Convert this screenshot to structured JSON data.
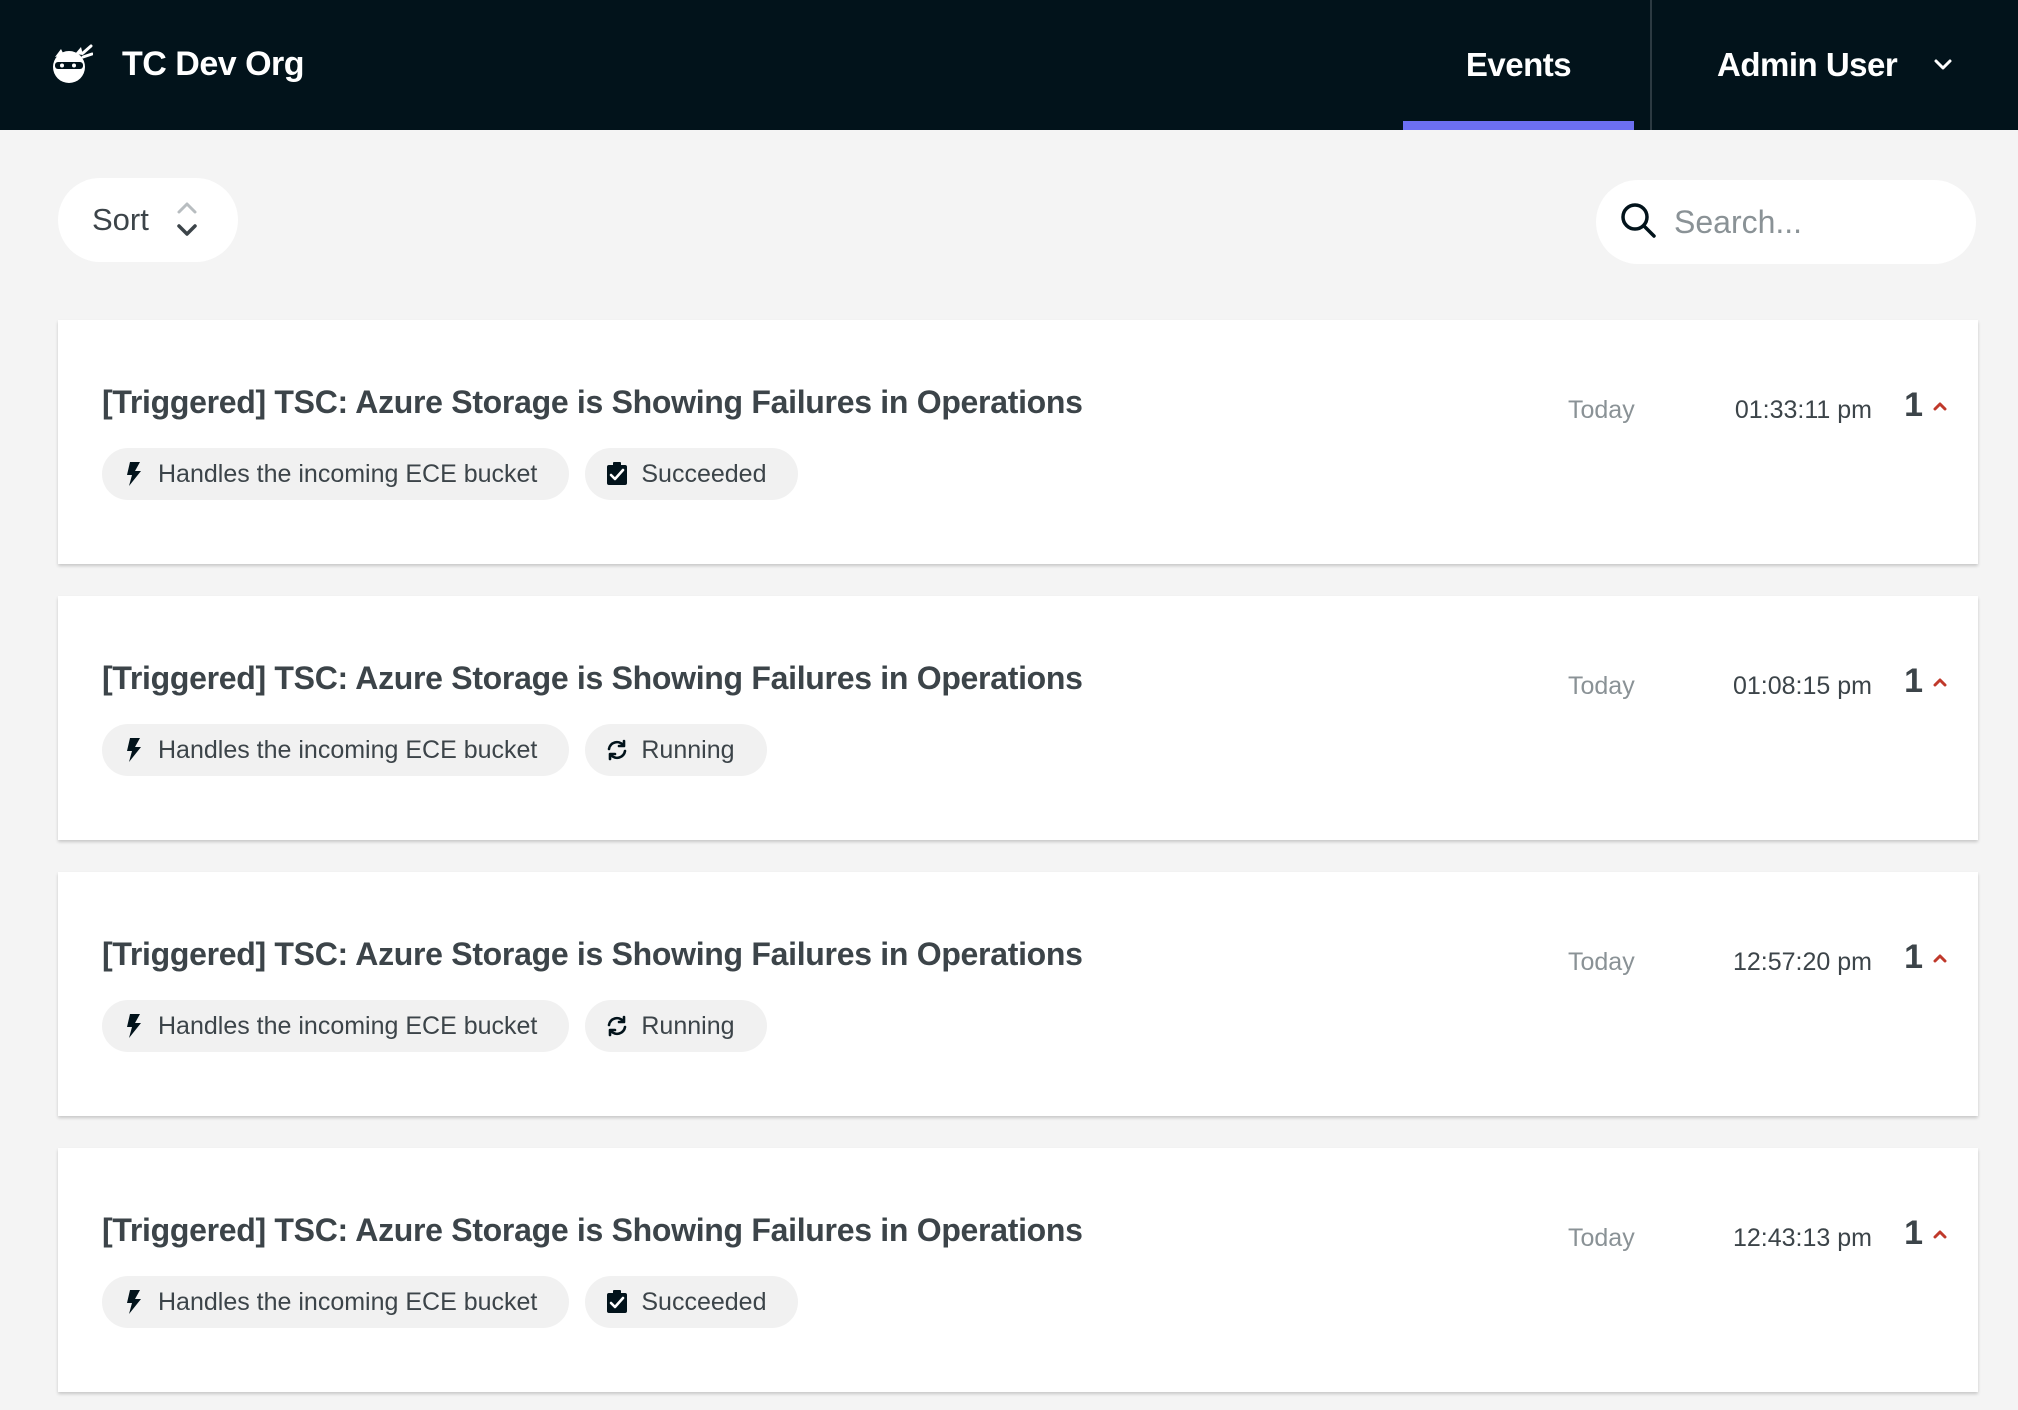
{
  "header": {
    "org_name": "TC Dev Org",
    "logo_icon": "ninja-cat-icon",
    "nav_events": "Events",
    "user_name": "Admin User",
    "accent_color": "#6c6ff2",
    "bg_color": "#02131b"
  },
  "toolbar": {
    "sort_label": "Sort",
    "search_placeholder": "Search..."
  },
  "events": [
    {
      "title": "[Triggered] TSC: Azure Storage is Showing Failures in Operations",
      "trigger": "Handles the incoming ECE bucket",
      "status": "Succeeded",
      "status_icon": "clipboard-check-icon",
      "date": "Today",
      "time": "01:33:11 pm",
      "count": "1"
    },
    {
      "title": "[Triggered] TSC: Azure Storage is Showing Failures in Operations",
      "trigger": "Handles the incoming ECE bucket",
      "status": "Running",
      "status_icon": "sync-icon",
      "date": "Today",
      "time": "01:08:15 pm",
      "count": "1"
    },
    {
      "title": "[Triggered] TSC: Azure Storage is Showing Failures in Operations",
      "trigger": "Handles the incoming ECE bucket",
      "status": "Running",
      "status_icon": "sync-icon",
      "date": "Today",
      "time": "12:57:20 pm",
      "count": "1"
    },
    {
      "title": "[Triggered] TSC: Azure Storage is Showing Failures in Operations",
      "trigger": "Handles the incoming ECE bucket",
      "status": "Succeeded",
      "status_icon": "clipboard-check-icon",
      "date": "Today",
      "time": "12:43:13 pm",
      "count": "1"
    }
  ]
}
